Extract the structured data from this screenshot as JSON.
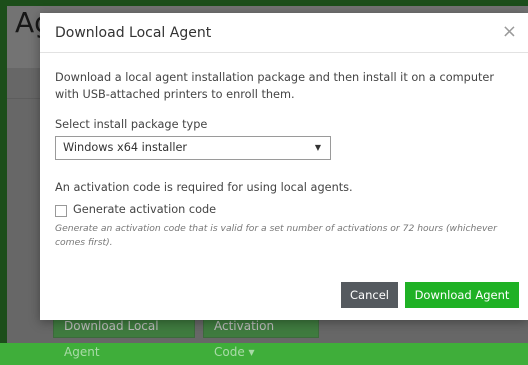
{
  "background_page": {
    "title": "Ag",
    "buttons": {
      "download_local_agent": "Download Local Agent",
      "activation_code": "Activation Code ▾"
    }
  },
  "modal": {
    "title": "Download Local Agent",
    "close_icon": "close-icon",
    "description": "Download a local agent installation package and then install it on a computer with USB-attached printers to enroll them.",
    "select_label": "Select install package type",
    "select_value": "Windows x64 installer",
    "activation_note": "An activation code is required for using local agents.",
    "checkbox_label": "Generate activation code",
    "checkbox_checked": false,
    "hint": "Generate an activation code that is valid for a set number of activations or 72 hours (whichever comes first).",
    "buttons": {
      "cancel": "Cancel",
      "download": "Download Agent"
    }
  },
  "colors": {
    "frame_green": "#3fae3a",
    "primary_button": "#1fb125",
    "secondary_button": "#555a5f"
  }
}
